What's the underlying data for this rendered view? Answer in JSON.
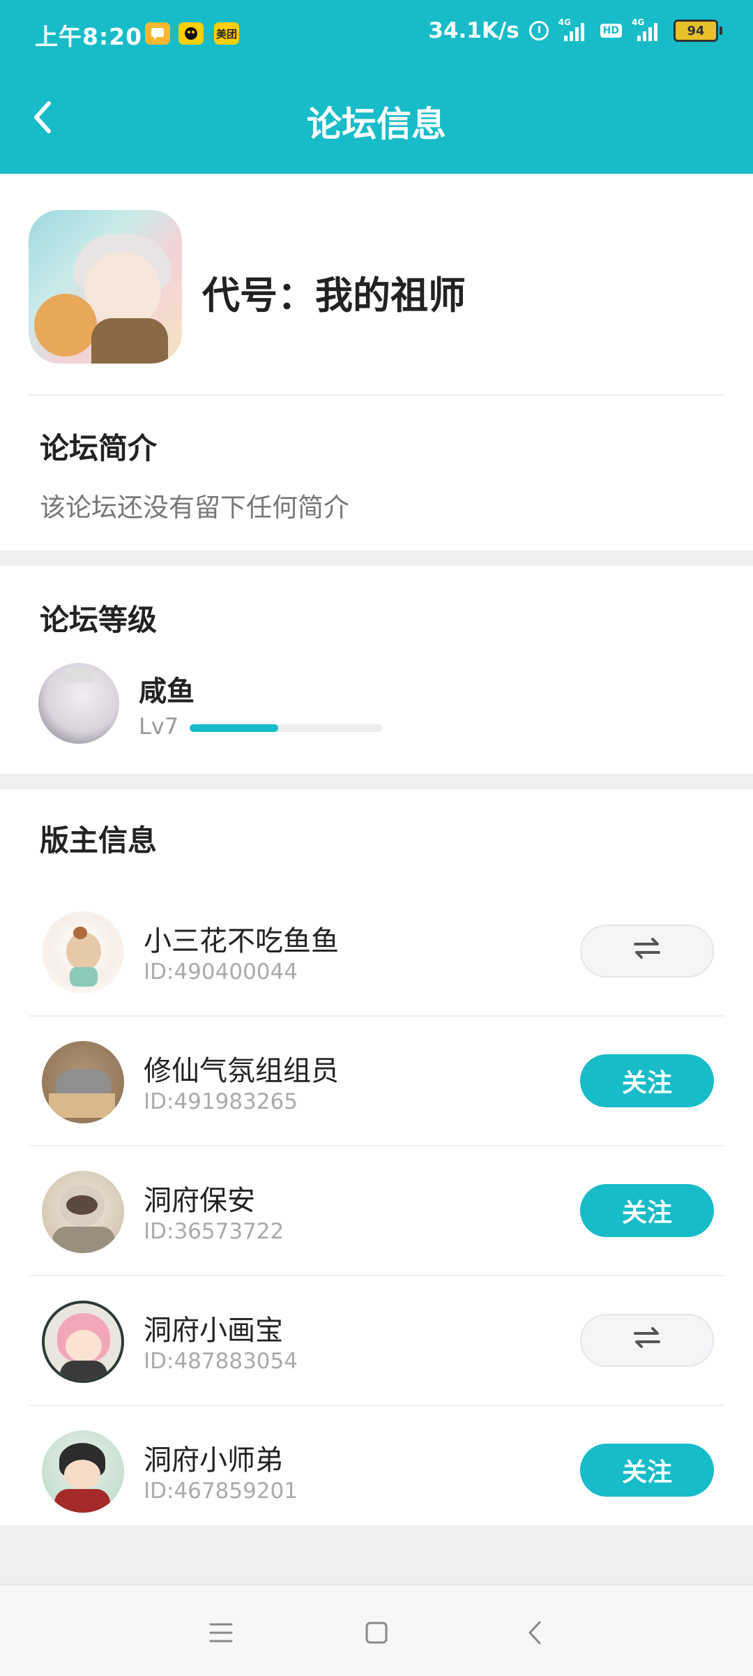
{
  "status_bar": {
    "time": "上午8:20",
    "notif_meituan": "美团",
    "net_speed": "34.1K/s",
    "net1": "4G",
    "hd": "HD",
    "net2": "4G",
    "battery": "94"
  },
  "header": {
    "title": "论坛信息"
  },
  "forum": {
    "name": "代号：我的祖师",
    "intro_title": "论坛简介",
    "intro_text": "该论坛还没有留下任何简介"
  },
  "level": {
    "section_title": "论坛等级",
    "user_name": "咸鱼",
    "lv_label": "Lv7",
    "progress": 0.46
  },
  "moderators": {
    "section_title": "版主信息",
    "items": [
      {
        "name": "小三花不吃鱼鱼",
        "id": "ID:490400044",
        "followed": true,
        "action_label": "⇌"
      },
      {
        "name": "修仙气氛组组员",
        "id": "ID:491983265",
        "followed": false,
        "action_label": "关注"
      },
      {
        "name": "洞府保安",
        "id": "ID:36573722",
        "followed": false,
        "action_label": "关注"
      },
      {
        "name": "洞府小画宝",
        "id": "ID:487883054",
        "followed": true,
        "action_label": "⇌"
      },
      {
        "name": "洞府小师弟",
        "id": "ID:467859201",
        "followed": false,
        "action_label": "关注"
      }
    ]
  },
  "colors": {
    "accent": "#17bcc8",
    "page_bg": "#efefef",
    "muted_text": "#aaaaaa"
  },
  "icons": {
    "back": "chevron-left-icon",
    "mutual": "swap-arrows-icon",
    "sys_menu": "menu-icon",
    "sys_home": "square-home-icon",
    "sys_back": "chevron-left-icon"
  }
}
